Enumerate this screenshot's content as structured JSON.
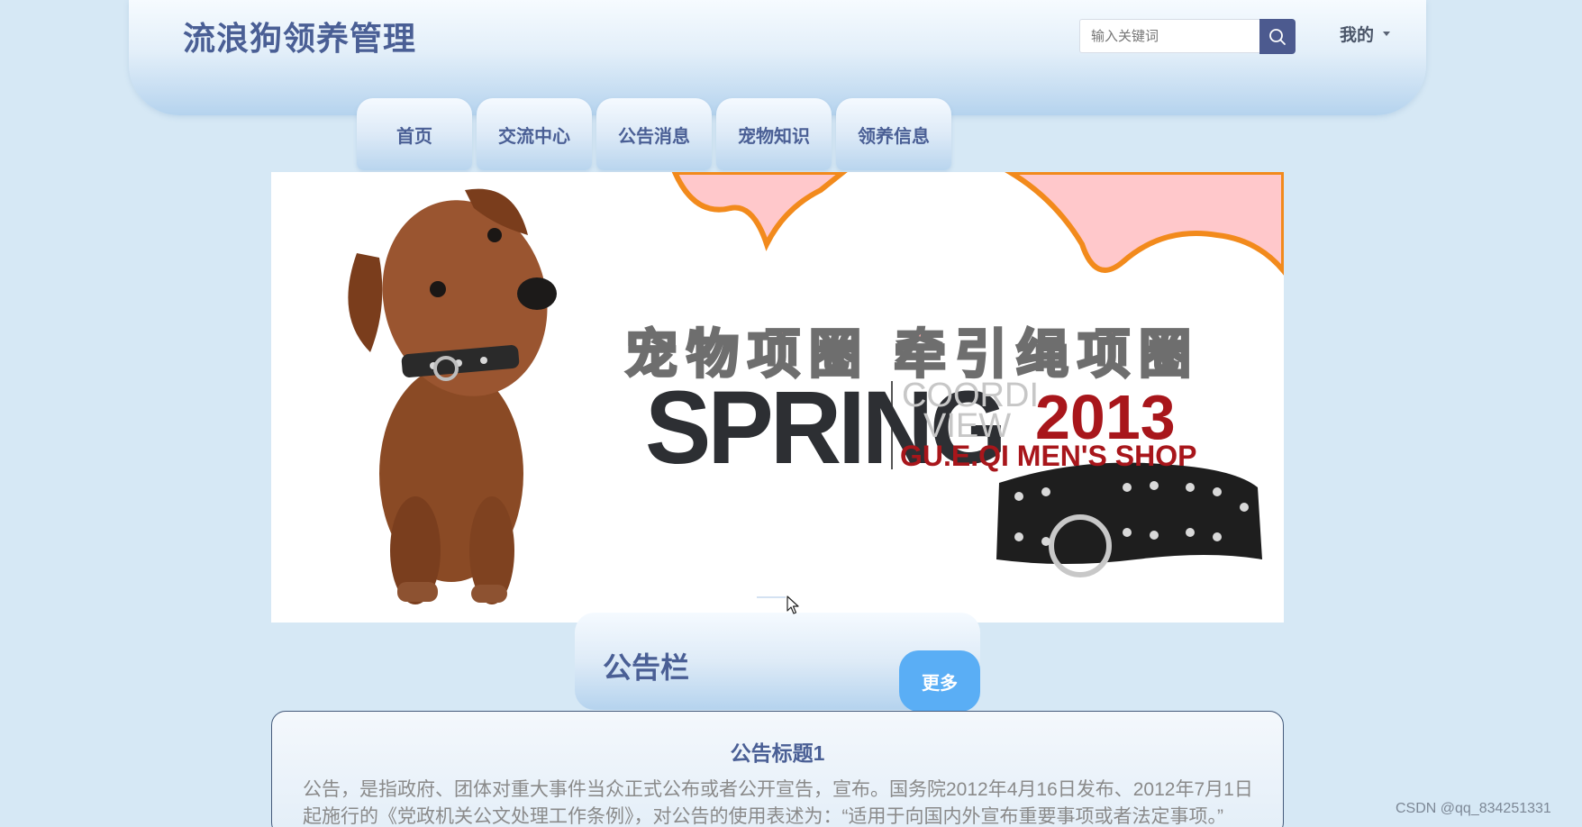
{
  "header": {
    "site_title": "流浪狗领养管理",
    "search_placeholder": "输入关键词",
    "user_menu_label": "我的"
  },
  "nav": {
    "tabs": [
      {
        "label": "首页"
      },
      {
        "label": "交流中心"
      },
      {
        "label": "公告消息"
      },
      {
        "label": "宠物知识"
      },
      {
        "label": "领养信息"
      }
    ]
  },
  "banner": {
    "headline_cn": "宠物项圈  牵引绳项圈",
    "headline_en": "SPRING",
    "sub_line1": "COORDI",
    "sub_line2": "VIEW",
    "year": "2013",
    "shop_name": "GU.E.QI  MEN'S  SHOP"
  },
  "notice": {
    "section_title": "公告栏",
    "more_label": "更多",
    "items": [
      {
        "title": "公告标题1",
        "body": "公告，是指政府、团体对重大事件当众正式公布或者公开宣告，宣布。国务院2012年4月16日发布、2012年7月1日起施行的《党政机关公文处理工作条例》，对公告的使用表述为：“适用于向国内外宣布重要事项或者法定事项。”"
      }
    ]
  },
  "watermark": "CSDN @qq_834251331",
  "colors": {
    "page_bg": "#d6e8f5",
    "title_text": "#4a5f95",
    "search_button": "#4c5a8f",
    "more_button": "#5aaef5"
  },
  "icons": {
    "search": "search-icon",
    "dropdown": "caret-down-icon"
  }
}
